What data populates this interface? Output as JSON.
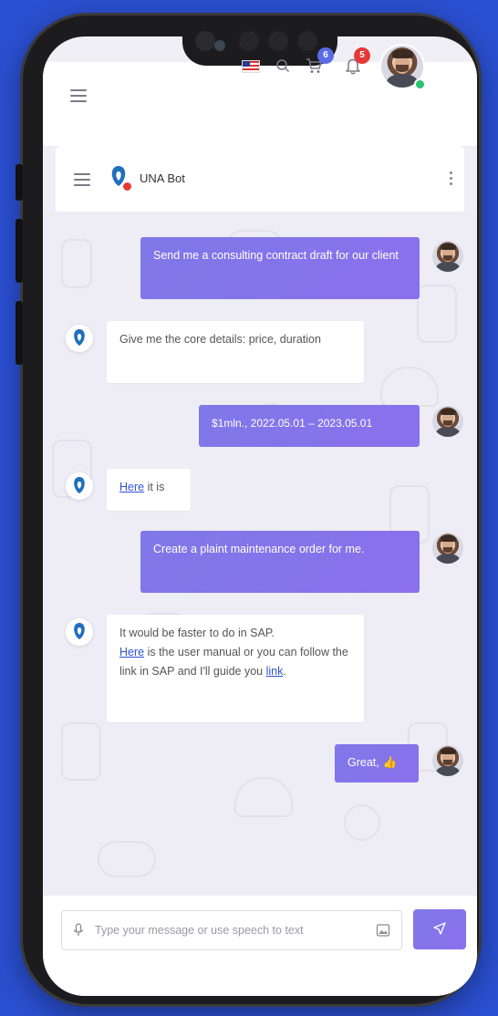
{
  "topbar": {
    "menu_icon": "hamburger-icon",
    "flag": "us-flag-icon",
    "search_icon": "search-icon",
    "cart_icon": "cart-icon",
    "cart_count": "6",
    "bell_icon": "bell-icon",
    "notification_count": "5",
    "badge_colors": {
      "cart": "#5a6bea",
      "notifications": "#e53935"
    }
  },
  "chat_header": {
    "menu_icon": "hamburger-icon",
    "title": "UNA Bot",
    "more_icon": "kebab-icon"
  },
  "messages": [
    {
      "from": "user",
      "text": "Send me a consulting contract draft for our client"
    },
    {
      "from": "bot",
      "text": "Give me the core details: price, duration"
    },
    {
      "from": "user",
      "text": "$1mln., 2022.05.01 – 2023.05.01"
    },
    {
      "from": "bot",
      "link": "Here",
      "text": " it is"
    },
    {
      "from": "user",
      "text": "Create a plaint maintenance order for me."
    },
    {
      "from": "bot",
      "line1": "It would be faster to do in SAP.",
      "link1": "Here",
      "text2": " is the user manual or you can follow the link in SAP and I'll guide you ",
      "link2": "link",
      "end": "."
    },
    {
      "from": "user",
      "text": "Great,",
      "emoji": "👍"
    }
  ],
  "composer": {
    "mic_icon": "microphone-icon",
    "placeholder": "Type your message or use speech to text",
    "attach_icon": "image-icon",
    "send_icon": "send-icon"
  },
  "colors": {
    "accent": "#8275ea",
    "background": "#2a4fd0",
    "link": "#2e53d6"
  }
}
